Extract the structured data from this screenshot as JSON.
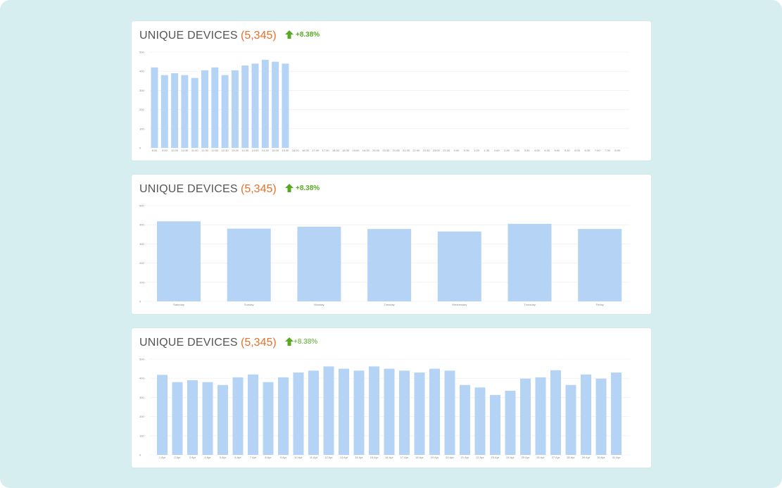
{
  "cards": [
    {
      "title": "UNIQUE DEVICES",
      "count": "(5,345)",
      "change": "+8.38%"
    },
    {
      "title": "UNIQUE DEVICES",
      "count": "(5,345)",
      "change": "+8.38%"
    },
    {
      "title": "UNIQUE DEVICES",
      "count": "(5,345)",
      "change": "+8.38%"
    }
  ],
  "colors": {
    "bar": "#b5d4f5",
    "grid": "#ececec",
    "accent": "#e8702a",
    "positive": "#55aa22"
  },
  "chart_data": [
    {
      "type": "bar",
      "xlabel": "",
      "ylabel": "",
      "ylim": [
        0,
        500
      ],
      "yticks": [
        0,
        100,
        200,
        300,
        400,
        500
      ],
      "grid": true,
      "categories": [
        "8:00",
        "9:00",
        "10:00",
        "10:30",
        "11:00",
        "11:30",
        "12:00",
        "12:30",
        "13:00",
        "13:30",
        "14:00",
        "14:30",
        "15:00",
        "15:30",
        "16:00",
        "16:30",
        "17:00",
        "17:30",
        "18:00",
        "18:30",
        "19:00",
        "19:30",
        "20:00",
        "20:30",
        "21:00",
        "21:30",
        "22:00",
        "22:30",
        "23:00",
        "23:30",
        "0:00",
        "0:30",
        "1:00",
        "1:30",
        "2:00",
        "2:30",
        "3:00",
        "3:30",
        "4:00",
        "4:30",
        "5:00",
        "5:30",
        "6:00",
        "6:30",
        "7:00",
        "7:30",
        "8:00"
      ],
      "values": [
        420,
        380,
        390,
        380,
        365,
        405,
        420,
        380,
        405,
        430,
        440,
        460,
        450,
        440
      ]
    },
    {
      "type": "bar",
      "xlabel": "",
      "ylabel": "",
      "ylim": [
        0,
        500
      ],
      "yticks": [
        0,
        100,
        200,
        300,
        400,
        500
      ],
      "grid": true,
      "categories": [
        "Saturday",
        "Sunday",
        "Monday",
        "Tuesday",
        "Wednesday",
        "Thursday",
        "Friday"
      ],
      "values": [
        418,
        380,
        390,
        378,
        365,
        405,
        378
      ]
    },
    {
      "type": "bar",
      "xlabel": "",
      "ylabel": "",
      "ylim": [
        0,
        500
      ],
      "yticks": [
        0,
        100,
        200,
        300,
        400,
        500
      ],
      "grid": true,
      "categories": [
        "1 Apr",
        "2 Apr",
        "3 Apr",
        "4 Apr",
        "5 Apr",
        "6 Apr",
        "7 Apr",
        "8 Apr",
        "9 Apr",
        "10 Apr",
        "11 Apr",
        "12 Apr",
        "13 Apr",
        "14 Apr",
        "15 Apr",
        "16 Apr",
        "17 Apr",
        "18 Apr",
        "19 Apr",
        "20 Apr",
        "21 Apr",
        "22 Apr",
        "23 Apr",
        "24 Apr",
        "25 Apr",
        "26 Apr",
        "27 Apr",
        "28 Apr",
        "29 Apr",
        "30 Apr",
        "31 Apr"
      ],
      "values": [
        418,
        380,
        390,
        380,
        365,
        405,
        420,
        380,
        405,
        430,
        440,
        462,
        450,
        440,
        462,
        450,
        440,
        430,
        450,
        440,
        365,
        352,
        313,
        335,
        398,
        405,
        442,
        365,
        420,
        398,
        430
      ]
    }
  ]
}
